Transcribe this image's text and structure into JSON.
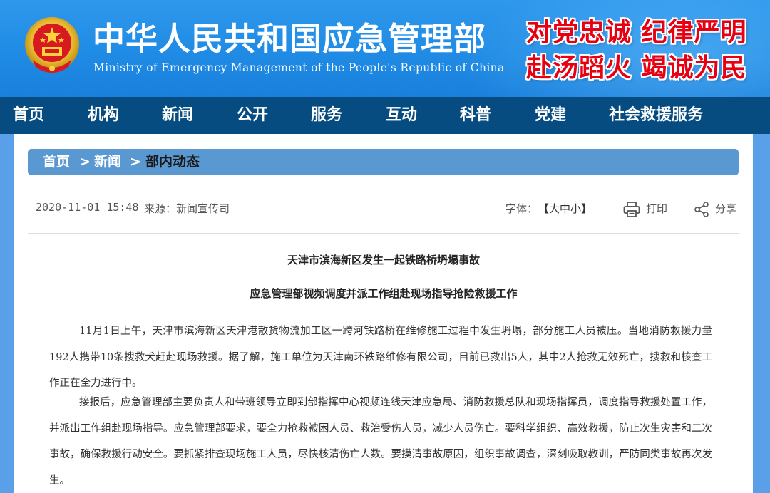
{
  "header": {
    "title_cn": "中华人民共和国应急管理部",
    "title_en": "Ministry of Emergency Management of the People's Republic of China",
    "slogan_line1": "对党忠诚 纪律严明",
    "slogan_line2": "赴汤蹈火 竭诚为民",
    "emblem_icon": "national-emblem-icon"
  },
  "nav": {
    "items": [
      "首页",
      "机构",
      "新闻",
      "公开",
      "服务",
      "互动",
      "科普",
      "党建",
      "社会救援服务"
    ]
  },
  "breadcrumb": {
    "home": "首页",
    "sep1": ">",
    "news": "新闻",
    "sep2": ">",
    "current": "部内动态"
  },
  "meta": {
    "datetime": "2020-11-01 15:48",
    "source": "来源：新闻宣传司",
    "font_label": "字体：",
    "font_sizes": "【大中小】",
    "print_label": "打印",
    "share_label": "分享",
    "print_icon": "printer-icon",
    "share_icon": "share-icon"
  },
  "article": {
    "title": "天津市滨海新区发生一起铁路桥坍塌事故",
    "subtitle": "应急管理部视频调度并派工作组赴现场指导抢险救援工作",
    "paragraphs": [
      "11月1日上午，天津市滨海新区天津港散货物流加工区一跨河铁路桥在维修施工过程中发生坍塌，部分施工人员被压。当地消防救援力量192人携带10条搜救犬赶赴现场救援。据了解，施工单位为天津南环铁路维修有限公司，目前已救出5人，其中2人抢救无效死亡，搜救和核查工作正在全力进行中。",
      "接报后，应急管理部主要负责人和带班领导立即到部指挥中心视频连线天津应急局、消防救援总队和现场指挥员，调度指导救援处置工作，并派出工作组赴现场指导。应急管理部要求，要全力抢救被困人员、救治受伤人员，减少人员伤亡。要科学组织、高效救援，防止次生灾害和二次事故，确保救援行动安全。要抓紧排查现场施工人员，尽快核清伤亡人数。要摸清事故原因，组织事故调查，深刻吸取教训，严防同类事故再次发生。"
    ]
  },
  "colors": {
    "banner_blue": "#1f8ae4",
    "nav_dark_blue": "#064c80",
    "breadcrumb_blue": "#5a98d2",
    "slogan_red": "#e60012",
    "page_side": "#5aa0e8"
  }
}
